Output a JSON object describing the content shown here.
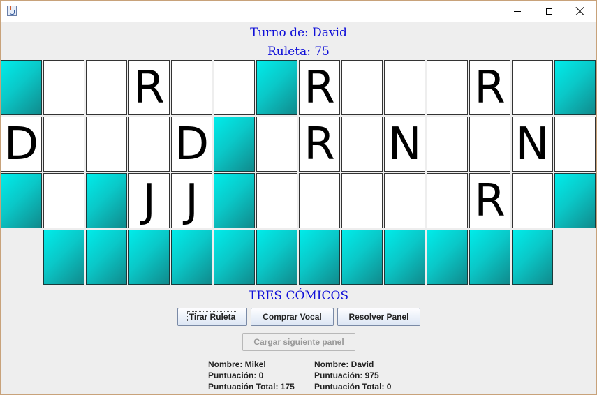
{
  "window": {
    "icon": "java-icon",
    "controls": [
      "minimize-icon",
      "maximize-icon",
      "close-icon"
    ]
  },
  "status": {
    "turn_text": "Turno de: David",
    "wheel_text": "Ruleta: 75"
  },
  "board": {
    "rows": [
      [
        null,
        " ",
        " ",
        "R",
        " ",
        " ",
        null,
        "R",
        " ",
        " ",
        " ",
        "R",
        " ",
        null
      ],
      [
        "D",
        " ",
        " ",
        " ",
        "D",
        null,
        " ",
        "R",
        " ",
        "N",
        " ",
        " ",
        "N",
        " "
      ],
      [
        null,
        " ",
        null,
        "J",
        "J",
        null,
        " ",
        " ",
        " ",
        " ",
        " ",
        "R",
        " ",
        null
      ],
      [
        "",
        null,
        null,
        null,
        null,
        null,
        null,
        null,
        null,
        null,
        null,
        null,
        null,
        ""
      ]
    ],
    "colors": {
      "filled_from": "#00ecea",
      "filled_to": "#108a8c",
      "text": "#000000"
    }
  },
  "clue": "TRES CÓMICOS",
  "buttons": {
    "spin": "Tirar Ruleta",
    "buy_vowel": "Comprar Vocal",
    "solve": "Resolver Panel",
    "next_panel": "Cargar siguiente panel"
  },
  "players": [
    {
      "name": "Nombre: Mikel",
      "score": "Puntuación: 0",
      "total": "Puntuación Total: 175"
    },
    {
      "name": "Nombre: David",
      "score": "Puntuación: 975",
      "total": "Puntuación Total: 0"
    }
  ],
  "accent_color": "#1010d8"
}
